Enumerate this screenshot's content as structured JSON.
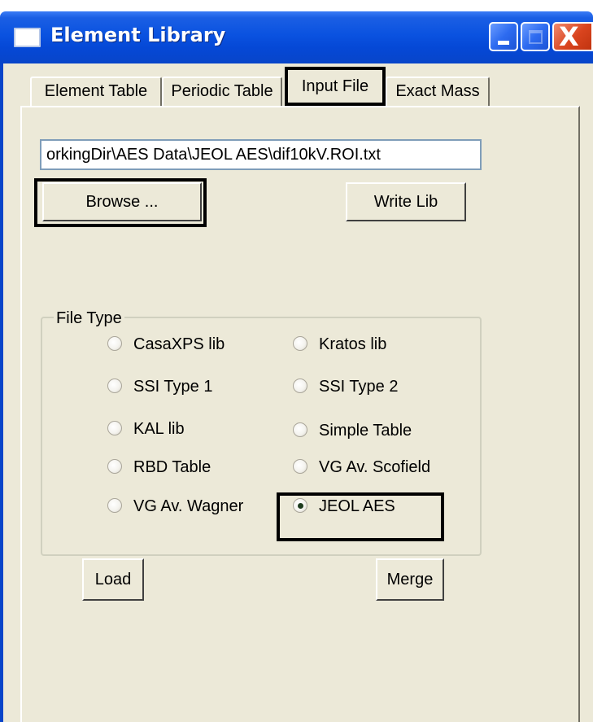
{
  "window": {
    "title": "Element Library",
    "controls": {
      "minimize": "minimize",
      "maximize": "maximize",
      "close": "X"
    }
  },
  "tabs": [
    {
      "label": "Element Table",
      "selected": false
    },
    {
      "label": "Periodic Table",
      "selected": false
    },
    {
      "label": "Input File",
      "selected": true
    },
    {
      "label": "Exact Mass",
      "selected": false
    }
  ],
  "input_file": {
    "path_value": "orkingDir\\AES Data\\JEOL AES\\dif10kV.ROI.txt",
    "browse_label": "Browse ...",
    "write_lib_label": "Write Lib",
    "file_type": {
      "legend": "File Type",
      "options": [
        {
          "label": "CasaXPS lib",
          "selected": false
        },
        {
          "label": "Kratos lib",
          "selected": false
        },
        {
          "label": "SSI Type 1",
          "selected": false
        },
        {
          "label": "SSI Type 2",
          "selected": false
        },
        {
          "label": "KAL lib",
          "selected": false
        },
        {
          "label": "Simple Table",
          "selected": false
        },
        {
          "label": "RBD Table",
          "selected": false
        },
        {
          "label": "VG Av. Scofield",
          "selected": false
        },
        {
          "label": "VG Av. Wagner",
          "selected": false
        },
        {
          "label": "JEOL AES",
          "selected": true
        }
      ]
    },
    "load_label": "Load",
    "merge_label": "Merge"
  },
  "colors": {
    "titlebar": "#0a52e0",
    "face": "#ece9d8",
    "highlight_box": "#000000"
  }
}
